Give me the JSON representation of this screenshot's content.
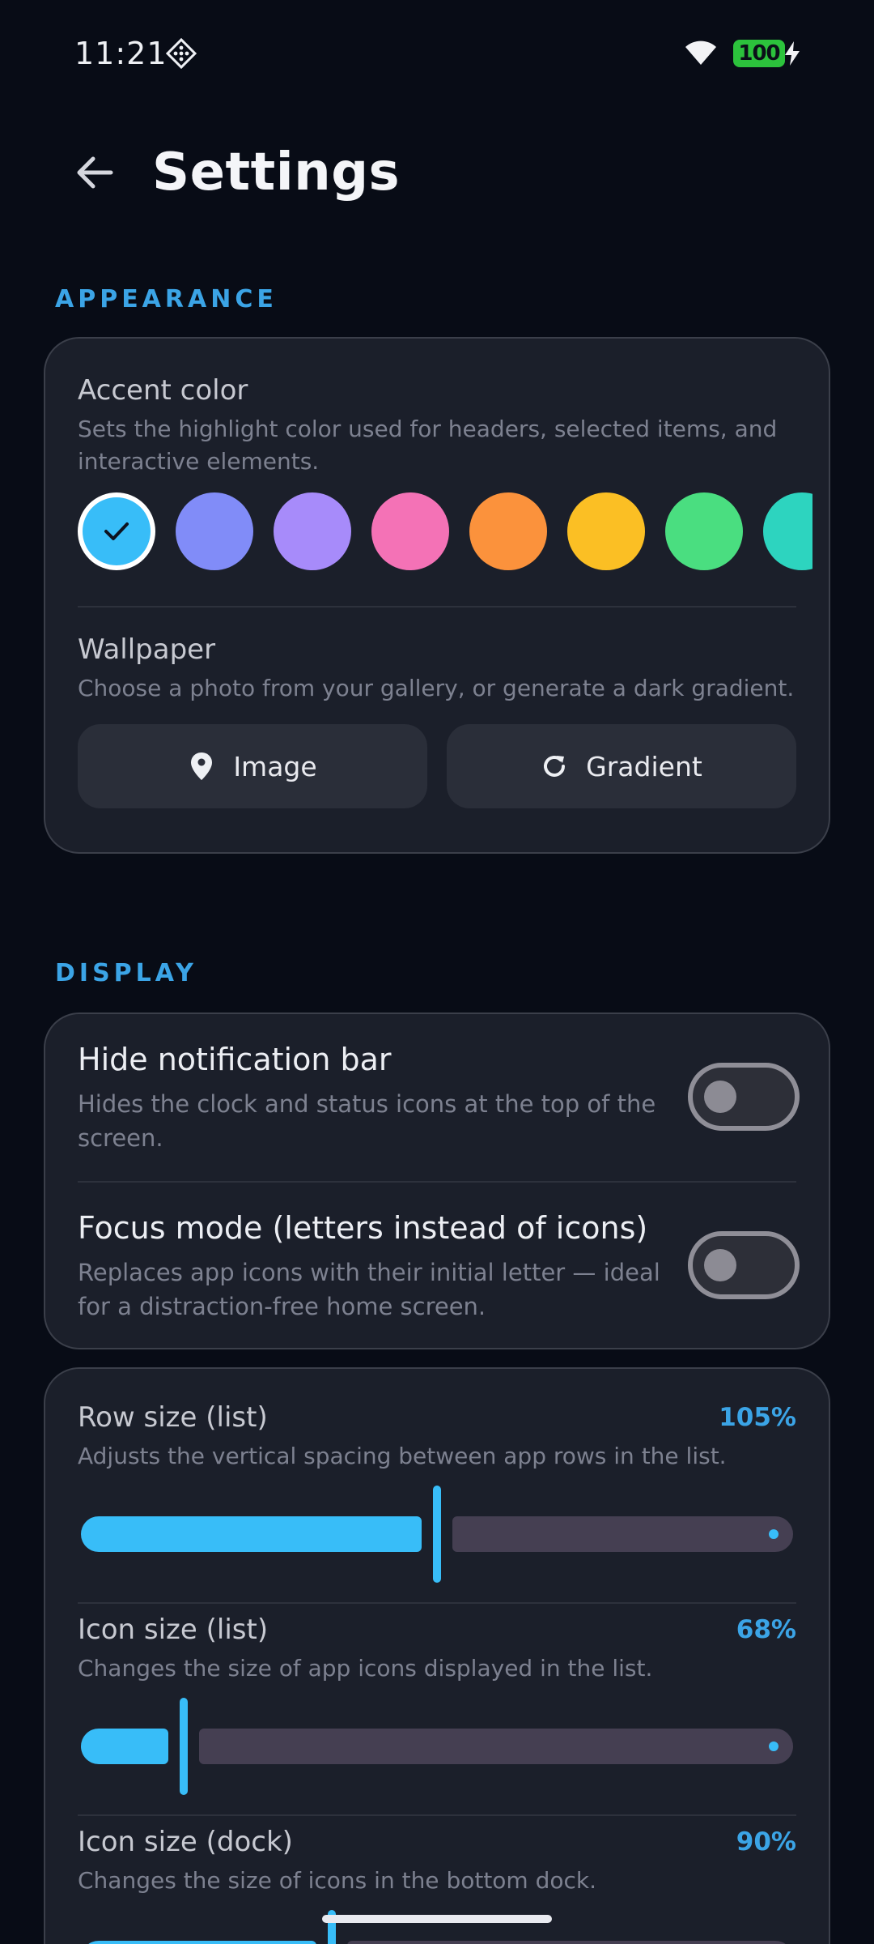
{
  "status_bar": {
    "time": "11:21",
    "battery": "100"
  },
  "header": {
    "title": "Settings"
  },
  "appearance": {
    "section_label": "APPEARANCE",
    "accent": {
      "title": "Accent color",
      "description": "Sets the highlight color used for headers, selected items, and interactive elements.",
      "swatches": [
        "#38bdf8",
        "#818cf8",
        "#a78bfa",
        "#f472b6",
        "#fb923c",
        "#fbbf24",
        "#4ade80",
        "#2dd4bf"
      ],
      "selected_index": 0
    },
    "wallpaper": {
      "title": "Wallpaper",
      "description": "Choose a photo from your gallery, or generate a dark gradient.",
      "image_button": "Image",
      "gradient_button": "Gradient"
    }
  },
  "display": {
    "section_label": "DISPLAY",
    "hide_notification": {
      "title": "Hide notification bar",
      "description": "Hides the clock and status icons at the top of the screen.",
      "enabled": false
    },
    "focus_mode": {
      "title": "Focus mode (letters instead of icons)",
      "description": "Replaces app icons with their initial letter — ideal for a distraction-free home screen.",
      "enabled": false
    },
    "row_size": {
      "title": "Row size (list)",
      "description": "Adjusts the vertical spacing between app rows in the list.",
      "value_label": "105%",
      "fraction": 0.5
    },
    "icon_size_list": {
      "title": "Icon size (list)",
      "description": "Changes the size of app icons displayed in the list.",
      "value_label": "68%",
      "fraction": 0.14
    },
    "icon_size_dock": {
      "title": "Icon size (dock)",
      "description": "Changes the size of icons in the bottom dock.",
      "value_label": "90%",
      "fraction": 0.35
    }
  },
  "colors": {
    "accent": "#38bdf8",
    "background": "#080c16",
    "card": "#1b1f2a"
  }
}
